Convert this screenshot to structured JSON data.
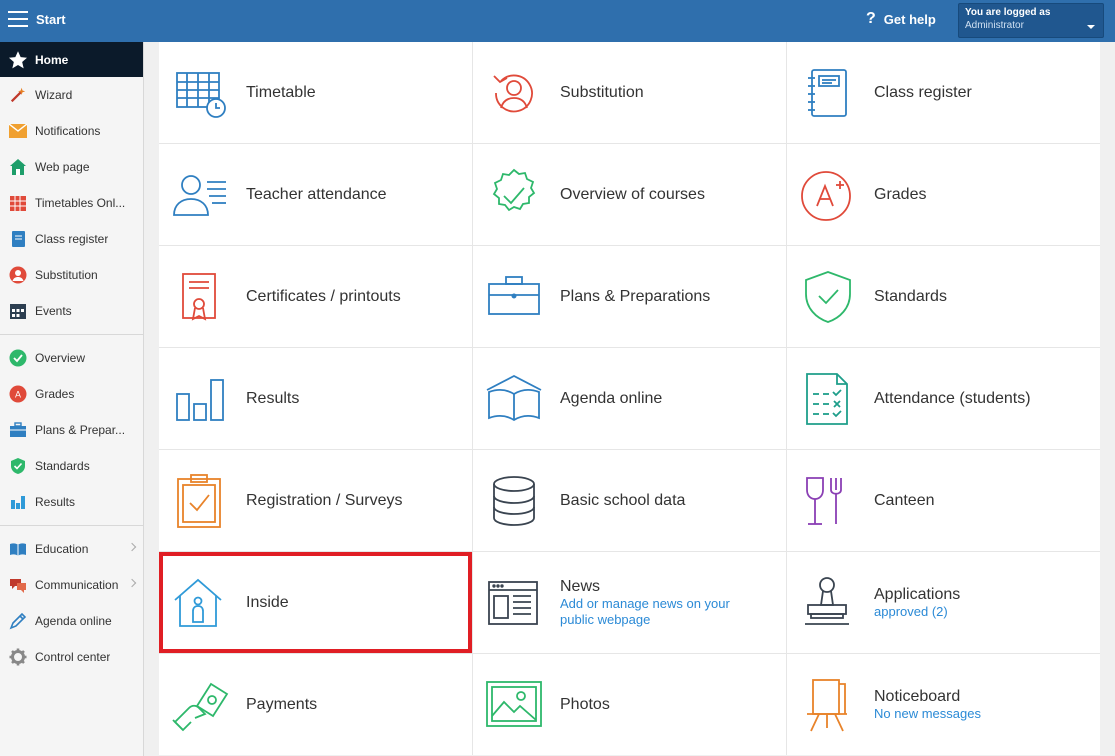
{
  "topbar": {
    "title": "Start",
    "help_label": "Get help",
    "help_symbol": "?",
    "login_line1": "You are logged as",
    "login_line2": "Administrator"
  },
  "sidebar": {
    "items": [
      {
        "label": "Home",
        "icon": "star-icon"
      },
      {
        "label": "Wizard",
        "icon": "wand-icon"
      },
      {
        "label": "Notifications",
        "icon": "envelope-icon"
      },
      {
        "label": "Web page",
        "icon": "home-icon"
      },
      {
        "label": "Timetables Onl...",
        "icon": "calendar-grid-icon"
      },
      {
        "label": "Class register",
        "icon": "notebook-icon"
      },
      {
        "label": "Substitution",
        "icon": "person-icon"
      },
      {
        "label": "Events",
        "icon": "calendar-icon"
      },
      {
        "label": "Overview",
        "icon": "check-circle-icon"
      },
      {
        "label": "Grades",
        "icon": "grade-badge-icon"
      },
      {
        "label": "Plans & Prepar...",
        "icon": "briefcase-icon"
      },
      {
        "label": "Standards",
        "icon": "shield-icon"
      },
      {
        "label": "Results",
        "icon": "bar-chart-icon"
      },
      {
        "label": "Education",
        "icon": "book-icon"
      },
      {
        "label": "Communication",
        "icon": "chat-icon"
      },
      {
        "label": "Agenda online",
        "icon": "pencil-icon"
      },
      {
        "label": "Control center",
        "icon": "gear-icon"
      }
    ]
  },
  "tiles": [
    {
      "title": "Timetable",
      "icon": "timetable-icon"
    },
    {
      "title": "Substitution",
      "icon": "substitution-icon"
    },
    {
      "title": "Class register",
      "icon": "class-register-icon"
    },
    {
      "title": "Teacher attendance",
      "icon": "teacher-attendance-icon"
    },
    {
      "title": "Overview of courses",
      "icon": "courses-check-icon"
    },
    {
      "title": "Grades",
      "icon": "grades-icon"
    },
    {
      "title": "Certificates / printouts",
      "icon": "certificate-icon"
    },
    {
      "title": "Plans & Preparations",
      "icon": "briefcase-icon"
    },
    {
      "title": "Standards",
      "icon": "shield-check-icon"
    },
    {
      "title": "Results",
      "icon": "bar-chart-icon"
    },
    {
      "title": "Agenda online",
      "icon": "open-book-icon"
    },
    {
      "title": "Attendance (students)",
      "icon": "attendance-list-icon"
    },
    {
      "title": "Registration / Surveys",
      "icon": "clipboard-check-icon"
    },
    {
      "title": "Basic school data",
      "icon": "database-icon"
    },
    {
      "title": "Canteen",
      "icon": "cutlery-icon"
    },
    {
      "title": "Inside",
      "icon": "house-person-icon"
    },
    {
      "title": "News",
      "subtitle": "Add or manage news on your public webpage",
      "icon": "newspaper-icon"
    },
    {
      "title": "Applications",
      "subtitle": "approved (2)",
      "icon": "stamp-icon"
    },
    {
      "title": "Payments",
      "icon": "money-hand-icon"
    },
    {
      "title": "Photos",
      "icon": "photo-icon"
    },
    {
      "title": "Noticeboard",
      "subtitle": "No new messages",
      "icon": "easel-icon"
    }
  ],
  "colors": {
    "topbar": "#2f6fad",
    "highlight": "#e01e24",
    "link": "#2b8ad6",
    "blue_icon": "#2f7fc1",
    "red_icon": "#e04a3a",
    "green_icon": "#2eb86b",
    "orange_icon": "#e8832a",
    "purple_icon": "#8a3fb4",
    "dark_icon": "#3a4450"
  }
}
